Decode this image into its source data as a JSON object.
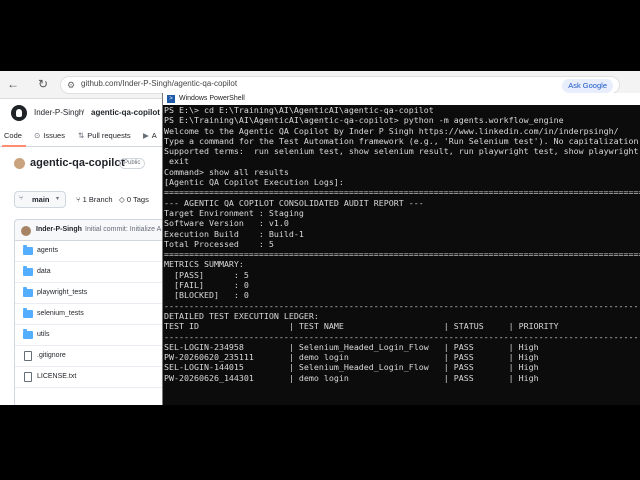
{
  "browser": {
    "back_glyph": "←",
    "refresh_glyph": "↻",
    "url_icon_glyph": "⚙",
    "url": "github.com/Inder-P-Singh/agentic-qa-copilot",
    "ask_google": "Ask Google"
  },
  "github": {
    "owner": "Inder-P-Singh",
    "slash": "/",
    "repo_short": "agentic-qa-copilot",
    "tabs": [
      {
        "icon": "<>",
        "label": "Code"
      },
      {
        "icon": "⊙",
        "label": "Issues"
      },
      {
        "icon": "⇅",
        "label": "Pull requests"
      },
      {
        "icon": "▶",
        "label": "A"
      }
    ],
    "repo_title": "agentic-qa-copilot",
    "visibility": "Public",
    "branch": "main",
    "branch_glyph": "⑂",
    "chevron_glyph": "▾",
    "branch_count": "⑂ 1 Branch",
    "tag_count": "◇ 0 Tags",
    "commit_author": "Inder-P-Singh",
    "commit_message": "Initial commit: Initialize A",
    "files": [
      {
        "name": "agents",
        "type": "folder"
      },
      {
        "name": "data",
        "type": "folder"
      },
      {
        "name": "playwright_tests",
        "type": "folder"
      },
      {
        "name": "selenium_tests",
        "type": "folder"
      },
      {
        "name": "utils",
        "type": "folder"
      },
      {
        "name": ".gitignore",
        "type": "file"
      },
      {
        "name": "LICENSE.txt",
        "type": "file"
      }
    ]
  },
  "powershell": {
    "icon_glyph": ">",
    "title": "Windows PowerShell",
    "lines": [
      "PS E:\\> cd E:\\Training\\AI\\AgenticAI\\agentic-qa-copilot",
      "PS E:\\Training\\AI\\AgenticAI\\agentic-qa-copilot> python -m agents.workflow_engine",
      "Welcome to the Agentic QA Copilot by Inder P Singh https://www.linkedin.com/in/inderpsingh/",
      "Type a command for the Test Automation framework (e.g., 'Run Selenium test'). No capitalization needed!",
      "Supported terms:  run selenium test, show selenium result, run playwright test, show playwright result,",
      " exit",
      "",
      "Command> show all results",
      "[Agentic QA Copilot Execution Logs]:",
      "",
      "========================================================================================================",
      "--- AGENTIC QA COPILOT CONSOLIDATED AUDIT REPORT ---",
      "Target Environment : Staging",
      "Software Version   : v1.0",
      "Execution Build    : Build-1",
      "Total Processed    : 5",
      "========================================================================================================",
      "METRICS SUMMARY:",
      "  [PASS]      : 5",
      "  [FAIL]      : 0",
      "  [BLOCKED]   : 0",
      "--------------------------------------------------------------------------------------------------------",
      "DETAILED TEST EXECUTION LEDGER:",
      "TEST ID                  | TEST NAME                    | STATUS     | PRIORITY",
      "--------------------------------------------------------------------------------------------------------",
      "SEL-LOGIN-234958         | Selenium_Headed_Login_Flow   | PASS       | High",
      "PW-20260620_235111       | demo login                   | PASS       | High",
      "SEL-LOGIN-144015         | Selenium_Headed_Login_Flow   | PASS       | High",
      "PW-20260626_144301       | demo login                   | PASS       | High"
    ]
  }
}
